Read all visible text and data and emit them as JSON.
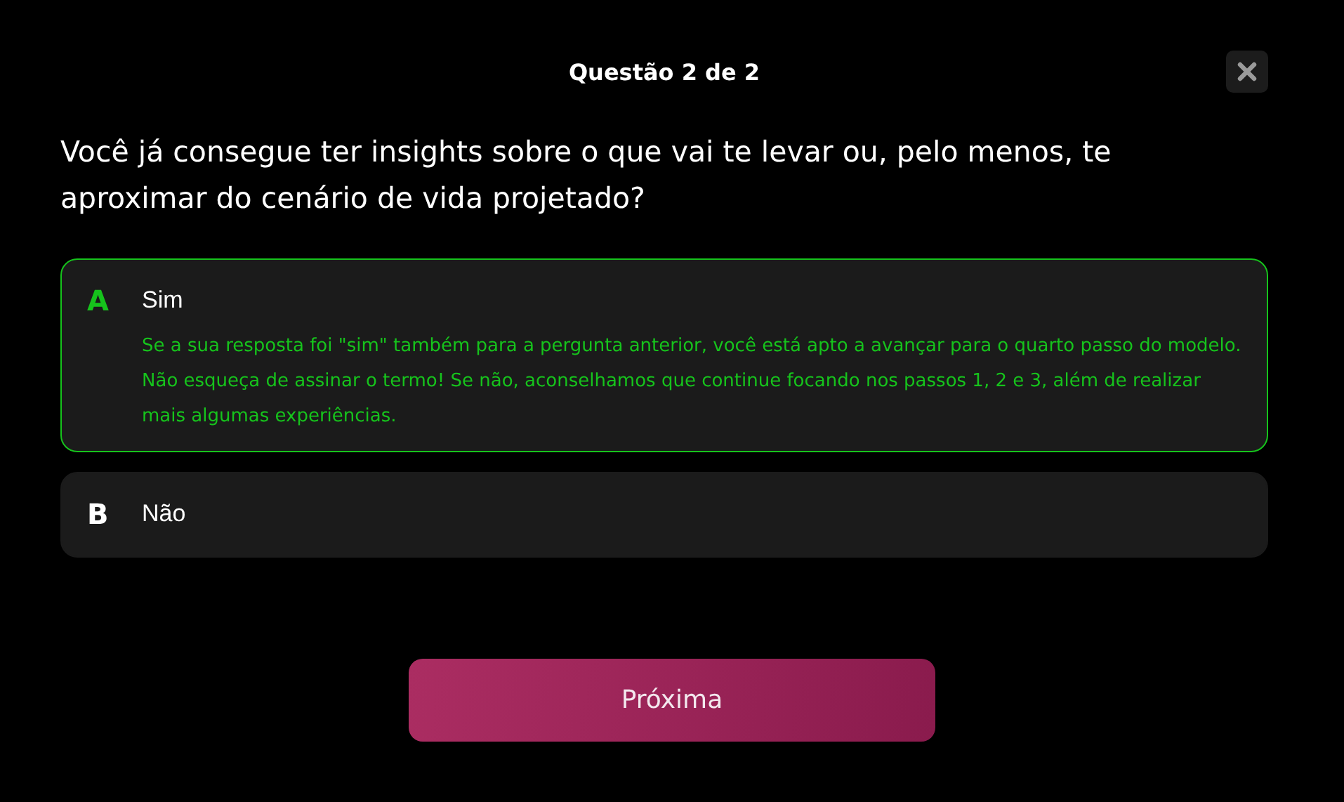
{
  "header": {
    "title": "Questão 2 de 2"
  },
  "question": "Você já consegue ter insights sobre o que vai te levar ou, pelo menos, te aproximar do cenário de vida projetado?",
  "options": [
    {
      "letter": "A",
      "label": "Sim",
      "selected": true,
      "feedback": "Se a sua resposta foi \"sim\" também para a pergunta anterior, você está apto a avançar para o quarto passo do modelo. Não esqueça de assinar o termo! Se não, aconselhamos que continue focando nos passos 1, 2 e 3, além de realizar mais algumas experiências."
    },
    {
      "letter": "B",
      "label": "Não",
      "selected": false
    }
  ],
  "next_button": "Próxima"
}
